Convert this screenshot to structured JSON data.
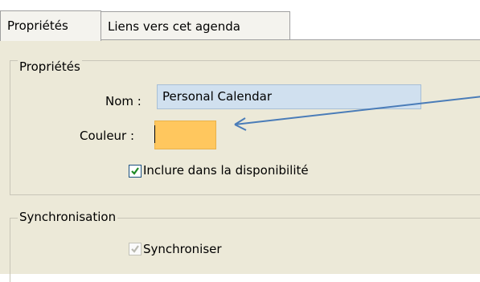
{
  "tabs": [
    {
      "label": "Propriétés",
      "active": true
    },
    {
      "label": "Liens vers cet agenda",
      "active": false
    }
  ],
  "properties": {
    "group_title": "Propriétés",
    "name_label": "Nom :",
    "name_value": "Personal Calendar",
    "color_label": "Couleur :",
    "color_value": "#ffc75e",
    "availability_label": "Inclure dans la disponibilité",
    "availability_checked": true
  },
  "sync": {
    "group_title": "Synchronisation",
    "synchronize_label": "Synchroniser",
    "synchronize_checked": true,
    "synchronize_enabled": false
  },
  "annotation": {
    "arrow_color": "#4a7cb8"
  }
}
